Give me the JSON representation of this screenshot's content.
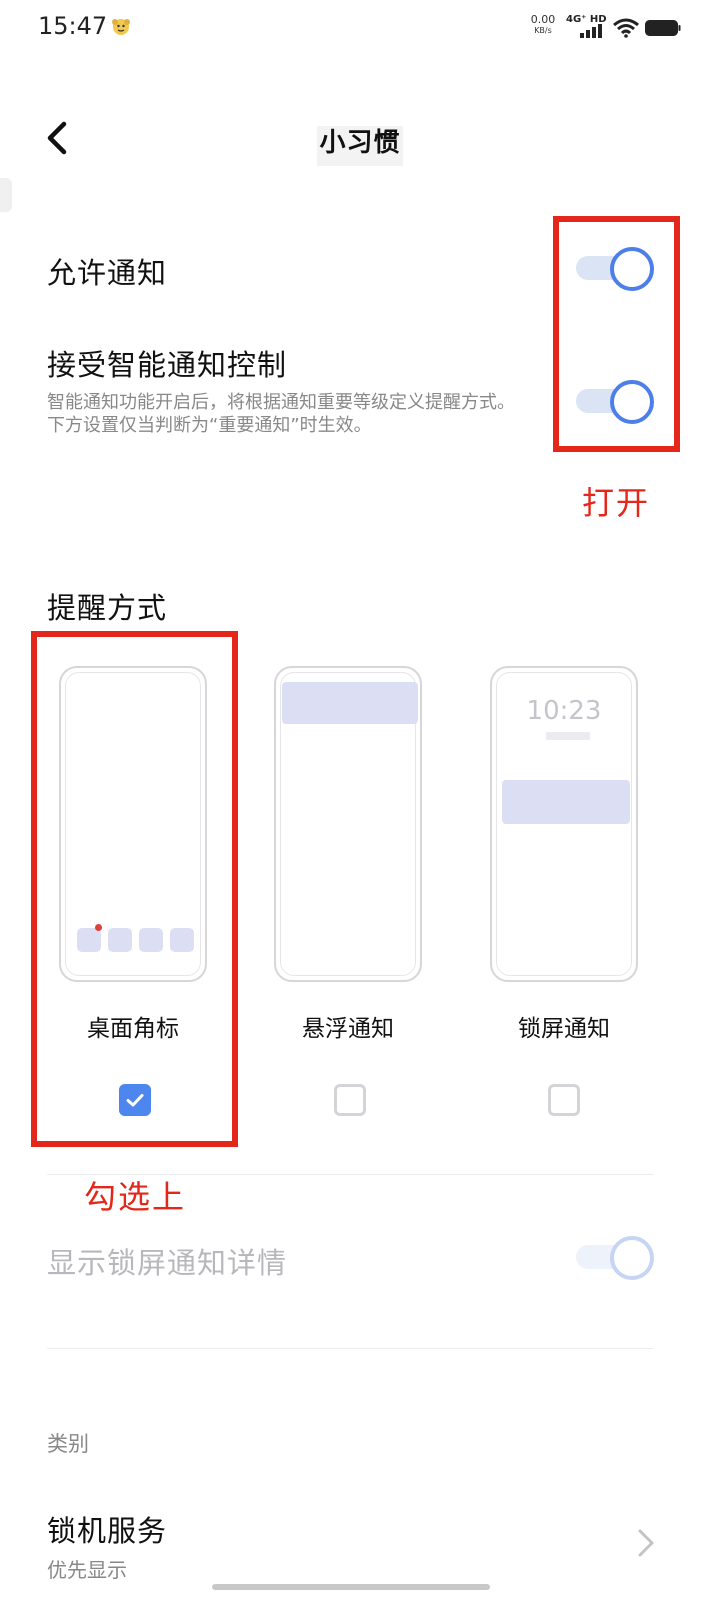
{
  "status_bar": {
    "time": "15:47",
    "net_speed": "0.00",
    "net_unit": "KB/s",
    "network": "4G⁺ HD"
  },
  "header": {
    "title": "小习惯"
  },
  "settings": {
    "allow_notification": {
      "label": "允许通知",
      "enabled": true
    },
    "smart_control": {
      "label": "接受智能通知控制",
      "desc": "智能通知功能开启后，将根据通知重要等级定义提醒方式。下方设置仅当判断为“重要通知”时生效。",
      "enabled": true
    }
  },
  "annotations": {
    "open": "打开",
    "check": "勾选上"
  },
  "reminder": {
    "title": "提醒方式",
    "options": [
      {
        "label": "桌面角标",
        "checked": true
      },
      {
        "label": "悬浮通知",
        "checked": false
      },
      {
        "label": "锁屏通知",
        "checked": false,
        "lock_time": "10:23"
      }
    ]
  },
  "lockscreen_details": {
    "label": "显示锁屏通知详情",
    "enabled": true,
    "disabled": true
  },
  "category": {
    "header": "类别",
    "item_label": "锁机服务",
    "item_sub": "优先显示"
  },
  "colors": {
    "accent": "#4d7fe8",
    "annotation": "#e3271a"
  }
}
